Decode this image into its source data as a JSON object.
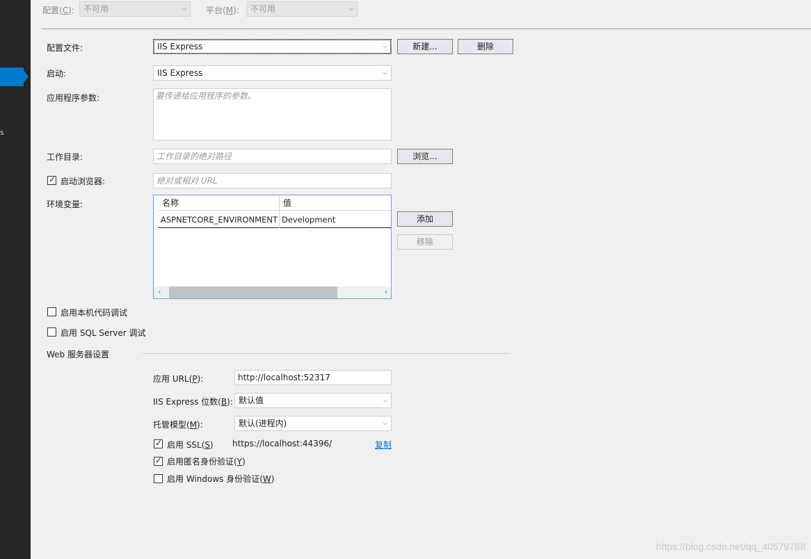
{
  "top": {
    "config_label": "配置",
    "config_key": "C",
    "config_value": "不可用",
    "platform_label": "平台",
    "platform_key": "M",
    "platform_value": "不可用"
  },
  "profile": {
    "label": "配置文件:",
    "value": "IIS Express",
    "new_btn": "新建...",
    "delete_btn": "删除"
  },
  "launch": {
    "label": "启动:",
    "value": "IIS Express"
  },
  "app_args": {
    "label": "应用程序参数:",
    "placeholder": "要传递给应用程序的参数。"
  },
  "working_dir": {
    "label": "工作目录:",
    "placeholder": "工作目录的绝对路径",
    "browse_btn": "浏览..."
  },
  "launch_browser": {
    "label": "启动浏览器:",
    "checked": true,
    "placeholder": "绝对或相对 URL"
  },
  "env": {
    "label": "环境变量:",
    "col_name": "名称",
    "col_value": "值",
    "rows": [
      {
        "name": "ASPNETCORE_ENVIRONMENT",
        "value": "Development"
      }
    ],
    "add_btn": "添加",
    "remove_btn": "移除"
  },
  "native_debug": {
    "label": "启用本机代码调试",
    "checked": false
  },
  "sql_debug": {
    "label": "启用 SQL Server 调试",
    "checked": false
  },
  "web_server": {
    "section_title": "Web 服务器设置",
    "app_url_label": "应用 URL(",
    "app_url_key": "P",
    "app_url_suffix": "):",
    "app_url_value": "http://localhost:52317",
    "bitness_label": "IIS Express 位数(",
    "bitness_key": "B",
    "bitness_suffix": "):",
    "bitness_value": "默认值",
    "hosting_label": "托管模型(",
    "hosting_key": "M",
    "hosting_suffix": "):",
    "hosting_value": "默认(进程内)",
    "ssl_label": "启用 SSL(",
    "ssl_key": "S",
    "ssl_suffix": ")",
    "ssl_checked": true,
    "ssl_url": "https://localhost:44396/",
    "copy_link": "复制",
    "anon_label": "启用匿名身份验证(",
    "anon_key": "Y",
    "anon_suffix": ")",
    "anon_checked": true,
    "windows_label": "启用 Windows 身份验证(",
    "windows_key": "W",
    "windows_suffix": ")",
    "windows_checked": false
  },
  "watermark": "https://blog.csdn.net/qq_40579788",
  "icons": {
    "chevron": "chevron-down-icon",
    "check": "check-icon",
    "scroll_left": "scroll-left-icon",
    "scroll_right": "scroll-right-icon"
  }
}
